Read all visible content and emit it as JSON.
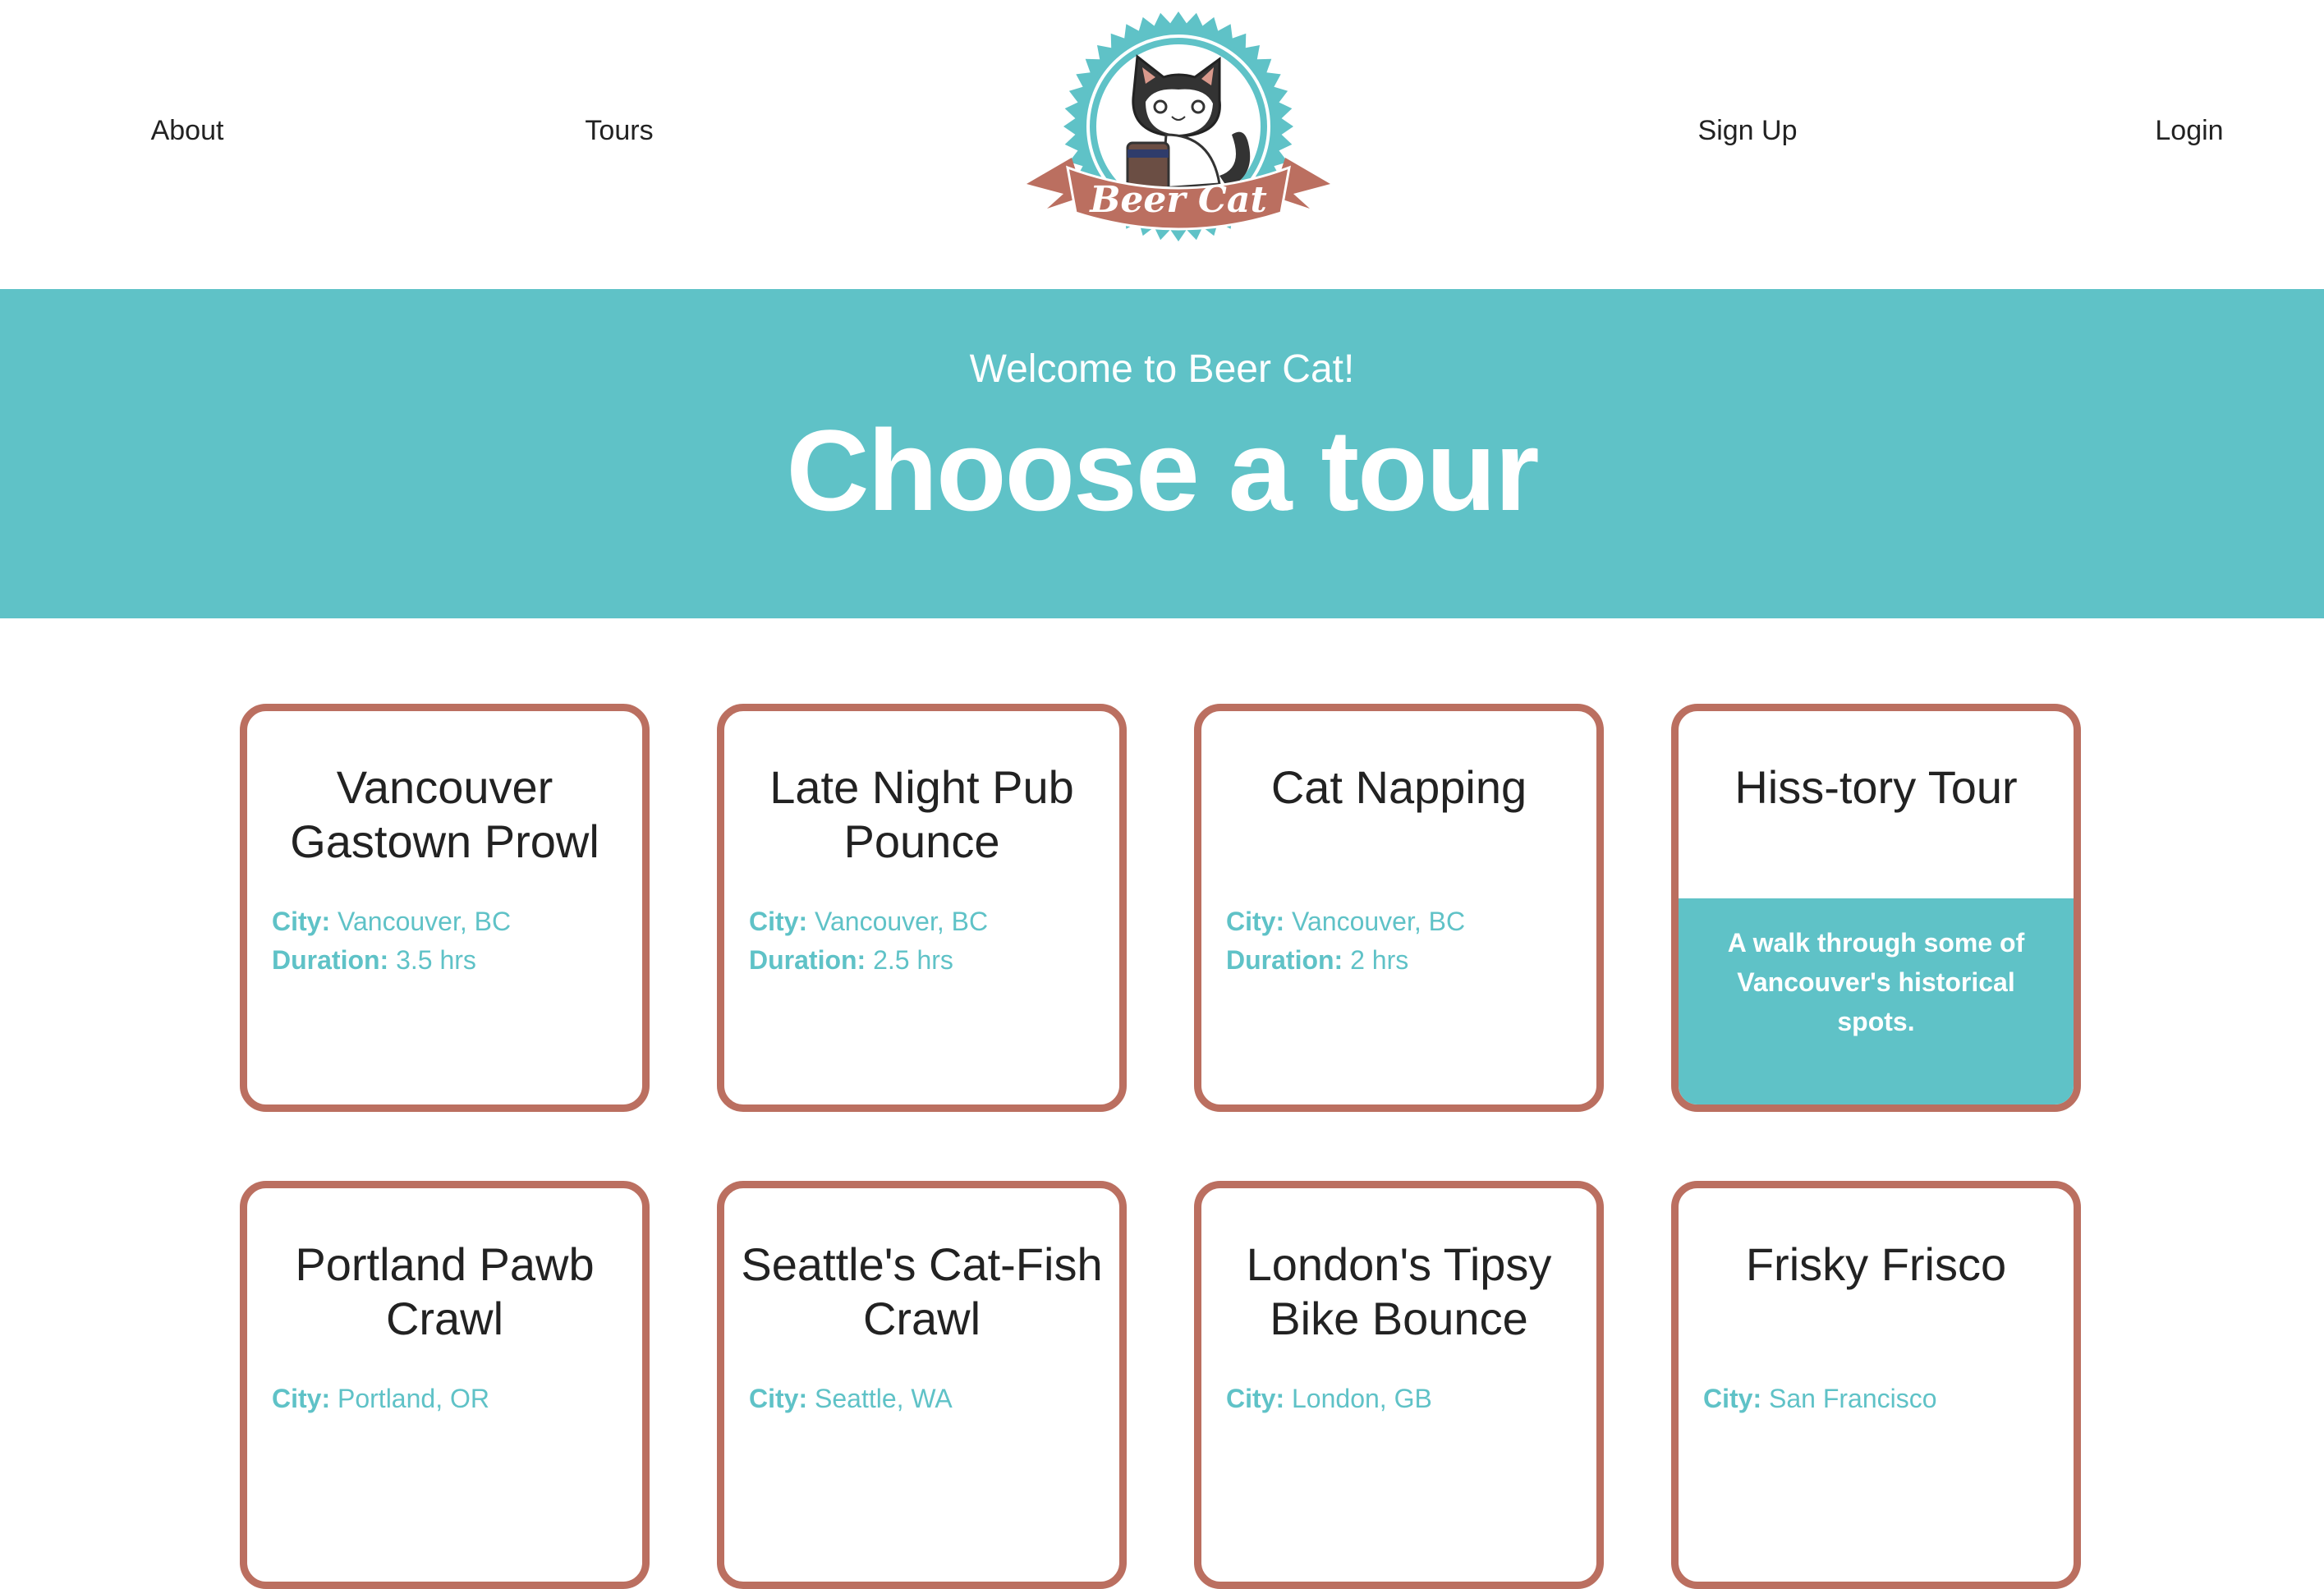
{
  "nav": {
    "about": "About",
    "tours": "Tours",
    "signup": "Sign Up",
    "login": "Login"
  },
  "logo": {
    "text": "Beer Cat"
  },
  "hero": {
    "welcome": "Welcome to Beer Cat!",
    "title": "Choose a tour"
  },
  "labels": {
    "city": "City:",
    "duration": "Duration:"
  },
  "tours": [
    {
      "title": "Vancouver Gastown Prowl",
      "city": "Vancouver, BC",
      "duration": "3.5 hrs"
    },
    {
      "title": "Late Night Pub Pounce",
      "city": "Vancouver, BC",
      "duration": "2.5 hrs"
    },
    {
      "title": "Cat Napping",
      "city": "Vancouver, BC",
      "duration": "2 hrs"
    },
    {
      "title": "Hiss-tory Tour",
      "description": "A walk through some of Vancouver's historical spots."
    },
    {
      "title": "Portland Pawb Crawl",
      "city": "Portland, OR"
    },
    {
      "title": "Seattle's Cat-Fish Crawl",
      "city": "Seattle, WA"
    },
    {
      "title": "London's Tipsy Bike Bounce",
      "city": "London, GB"
    },
    {
      "title": "Frisky Frisco",
      "city": "San Francisco"
    }
  ],
  "colors": {
    "teal": "#5fc2c7",
    "border": "#bb6f60"
  }
}
